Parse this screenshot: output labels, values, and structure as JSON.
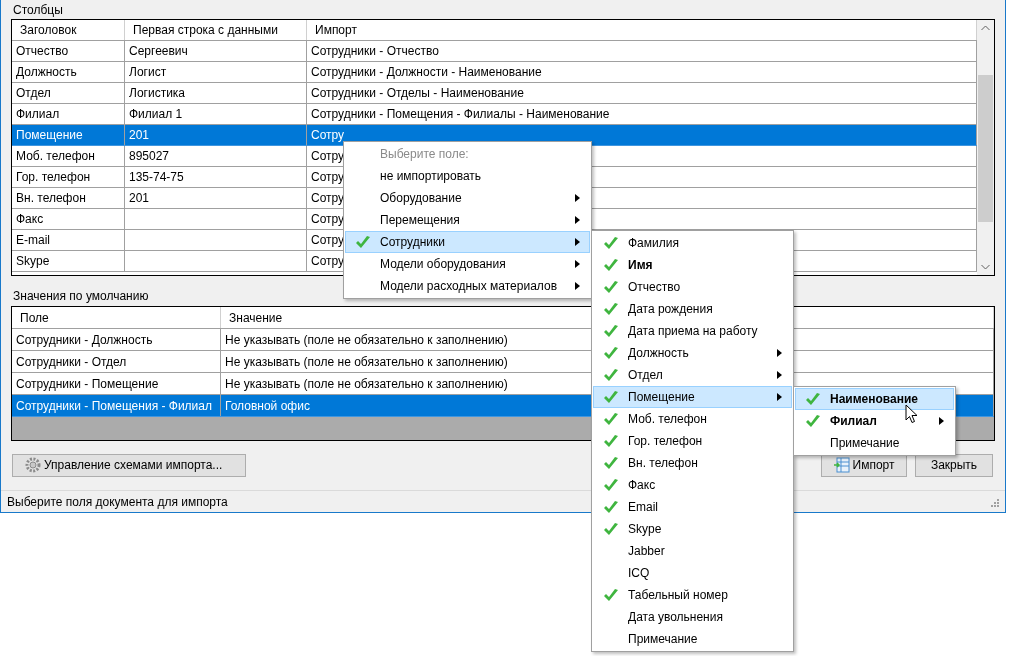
{
  "columns_group": {
    "title": "Столбцы",
    "columns": [
      "Заголовок",
      "Первая строка с данными",
      "Импорт"
    ],
    "rows": [
      {
        "cells": [
          "Отчество",
          "Сергеевич",
          "Сотрудники - Отчество"
        ],
        "selected": false
      },
      {
        "cells": [
          "Должность",
          "Логист",
          "Сотрудники - Должности - Наименование"
        ],
        "selected": false
      },
      {
        "cells": [
          "Отдел",
          "Логистика",
          "Сотрудники - Отделы - Наименование"
        ],
        "selected": false
      },
      {
        "cells": [
          "Филиал",
          "Филиал 1",
          "Сотрудники - Помещения - Филиалы - Наименование"
        ],
        "selected": false
      },
      {
        "cells": [
          "Помещение",
          "201",
          "Сотру"
        ],
        "selected": true
      },
      {
        "cells": [
          "Моб. телефон",
          "895027",
          "Сотру"
        ],
        "selected": false
      },
      {
        "cells": [
          "Гор. телефон",
          "135-74-75",
          "Сотру"
        ],
        "selected": false
      },
      {
        "cells": [
          "Вн. телефон",
          "201",
          "Сотру"
        ],
        "selected": false
      },
      {
        "cells": [
          "Факс",
          "",
          "Сотру"
        ],
        "selected": false
      },
      {
        "cells": [
          "E-mail",
          "",
          "Сотру"
        ],
        "selected": false
      },
      {
        "cells": [
          "Skype",
          "",
          "Сотру"
        ],
        "selected": false
      }
    ]
  },
  "defaults_group": {
    "title": "Значения по умолчанию",
    "columns": [
      "Поле",
      "Значение"
    ],
    "rows": [
      {
        "cells": [
          "Сотрудники - Должность",
          "Не указывать (поле не обязательно к заполнению)"
        ],
        "selected": false
      },
      {
        "cells": [
          "Сотрудники - Отдел",
          "Не указывать (поле не обязательно к заполнению)"
        ],
        "selected": false
      },
      {
        "cells": [
          "Сотрудники - Помещение",
          "Не указывать (поле не обязательно к заполнению)"
        ],
        "selected": false
      },
      {
        "cells": [
          "Сотрудники - Помещения - Филиал",
          "Головной офис"
        ],
        "selected": true
      }
    ]
  },
  "buttons": {
    "manage": "Управление схемами импорта...",
    "import": "Импорт",
    "close": "Закрыть"
  },
  "status_bar": "Выберите поля документа для импорта",
  "menus": [
    {
      "title": "Выберите поле:",
      "items": [
        {
          "label": "не импортировать",
          "checked": false,
          "submenu": false,
          "selected": false,
          "bold": false
        },
        {
          "label": "Оборудование",
          "checked": false,
          "submenu": true,
          "selected": false,
          "bold": false
        },
        {
          "label": "Перемещения",
          "checked": false,
          "submenu": true,
          "selected": false,
          "bold": false
        },
        {
          "label": "Сотрудники",
          "checked": true,
          "submenu": true,
          "selected": true,
          "bold": false
        },
        {
          "label": "Модели оборудования",
          "checked": false,
          "submenu": true,
          "selected": false,
          "bold": false
        },
        {
          "label": "Модели расходных материалов",
          "checked": false,
          "submenu": true,
          "selected": false,
          "bold": false
        }
      ]
    },
    {
      "items": [
        {
          "label": "Фамилия",
          "checked": true,
          "submenu": false,
          "selected": false,
          "bold": false
        },
        {
          "label": "Имя",
          "checked": true,
          "submenu": false,
          "selected": false,
          "bold": true
        },
        {
          "label": "Отчество",
          "checked": true,
          "submenu": false,
          "selected": false,
          "bold": false
        },
        {
          "label": "Дата рождения",
          "checked": true,
          "submenu": false,
          "selected": false,
          "bold": false
        },
        {
          "label": "Дата приема на работу",
          "checked": true,
          "submenu": false,
          "selected": false,
          "bold": false
        },
        {
          "label": "Должность",
          "checked": true,
          "submenu": true,
          "selected": false,
          "bold": false
        },
        {
          "label": "Отдел",
          "checked": true,
          "submenu": true,
          "selected": false,
          "bold": false
        },
        {
          "label": "Помещение",
          "checked": true,
          "submenu": true,
          "selected": true,
          "bold": false
        },
        {
          "label": "Моб. телефон",
          "checked": true,
          "submenu": false,
          "selected": false,
          "bold": false
        },
        {
          "label": "Гор. телефон",
          "checked": true,
          "submenu": false,
          "selected": false,
          "bold": false
        },
        {
          "label": "Вн. телефон",
          "checked": true,
          "submenu": false,
          "selected": false,
          "bold": false
        },
        {
          "label": "Факс",
          "checked": true,
          "submenu": false,
          "selected": false,
          "bold": false
        },
        {
          "label": "Email",
          "checked": true,
          "submenu": false,
          "selected": false,
          "bold": false
        },
        {
          "label": "Skype",
          "checked": true,
          "submenu": false,
          "selected": false,
          "bold": false
        },
        {
          "label": "Jabber",
          "checked": false,
          "submenu": false,
          "selected": false,
          "bold": false
        },
        {
          "label": "ICQ",
          "checked": false,
          "submenu": false,
          "selected": false,
          "bold": false
        },
        {
          "label": "Табельный номер",
          "checked": true,
          "submenu": false,
          "selected": false,
          "bold": false
        },
        {
          "label": "Дата увольнения",
          "checked": false,
          "submenu": false,
          "selected": false,
          "bold": false
        },
        {
          "label": "Примечание",
          "checked": false,
          "submenu": false,
          "selected": false,
          "bold": false
        }
      ]
    },
    {
      "items": [
        {
          "label": "Наименование",
          "checked": true,
          "submenu": false,
          "selected": true,
          "bold": true
        },
        {
          "label": "Филиал",
          "checked": true,
          "submenu": true,
          "selected": false,
          "bold": true
        },
        {
          "label": "Примечание",
          "checked": false,
          "submenu": false,
          "selected": false,
          "bold": false
        }
      ]
    }
  ]
}
